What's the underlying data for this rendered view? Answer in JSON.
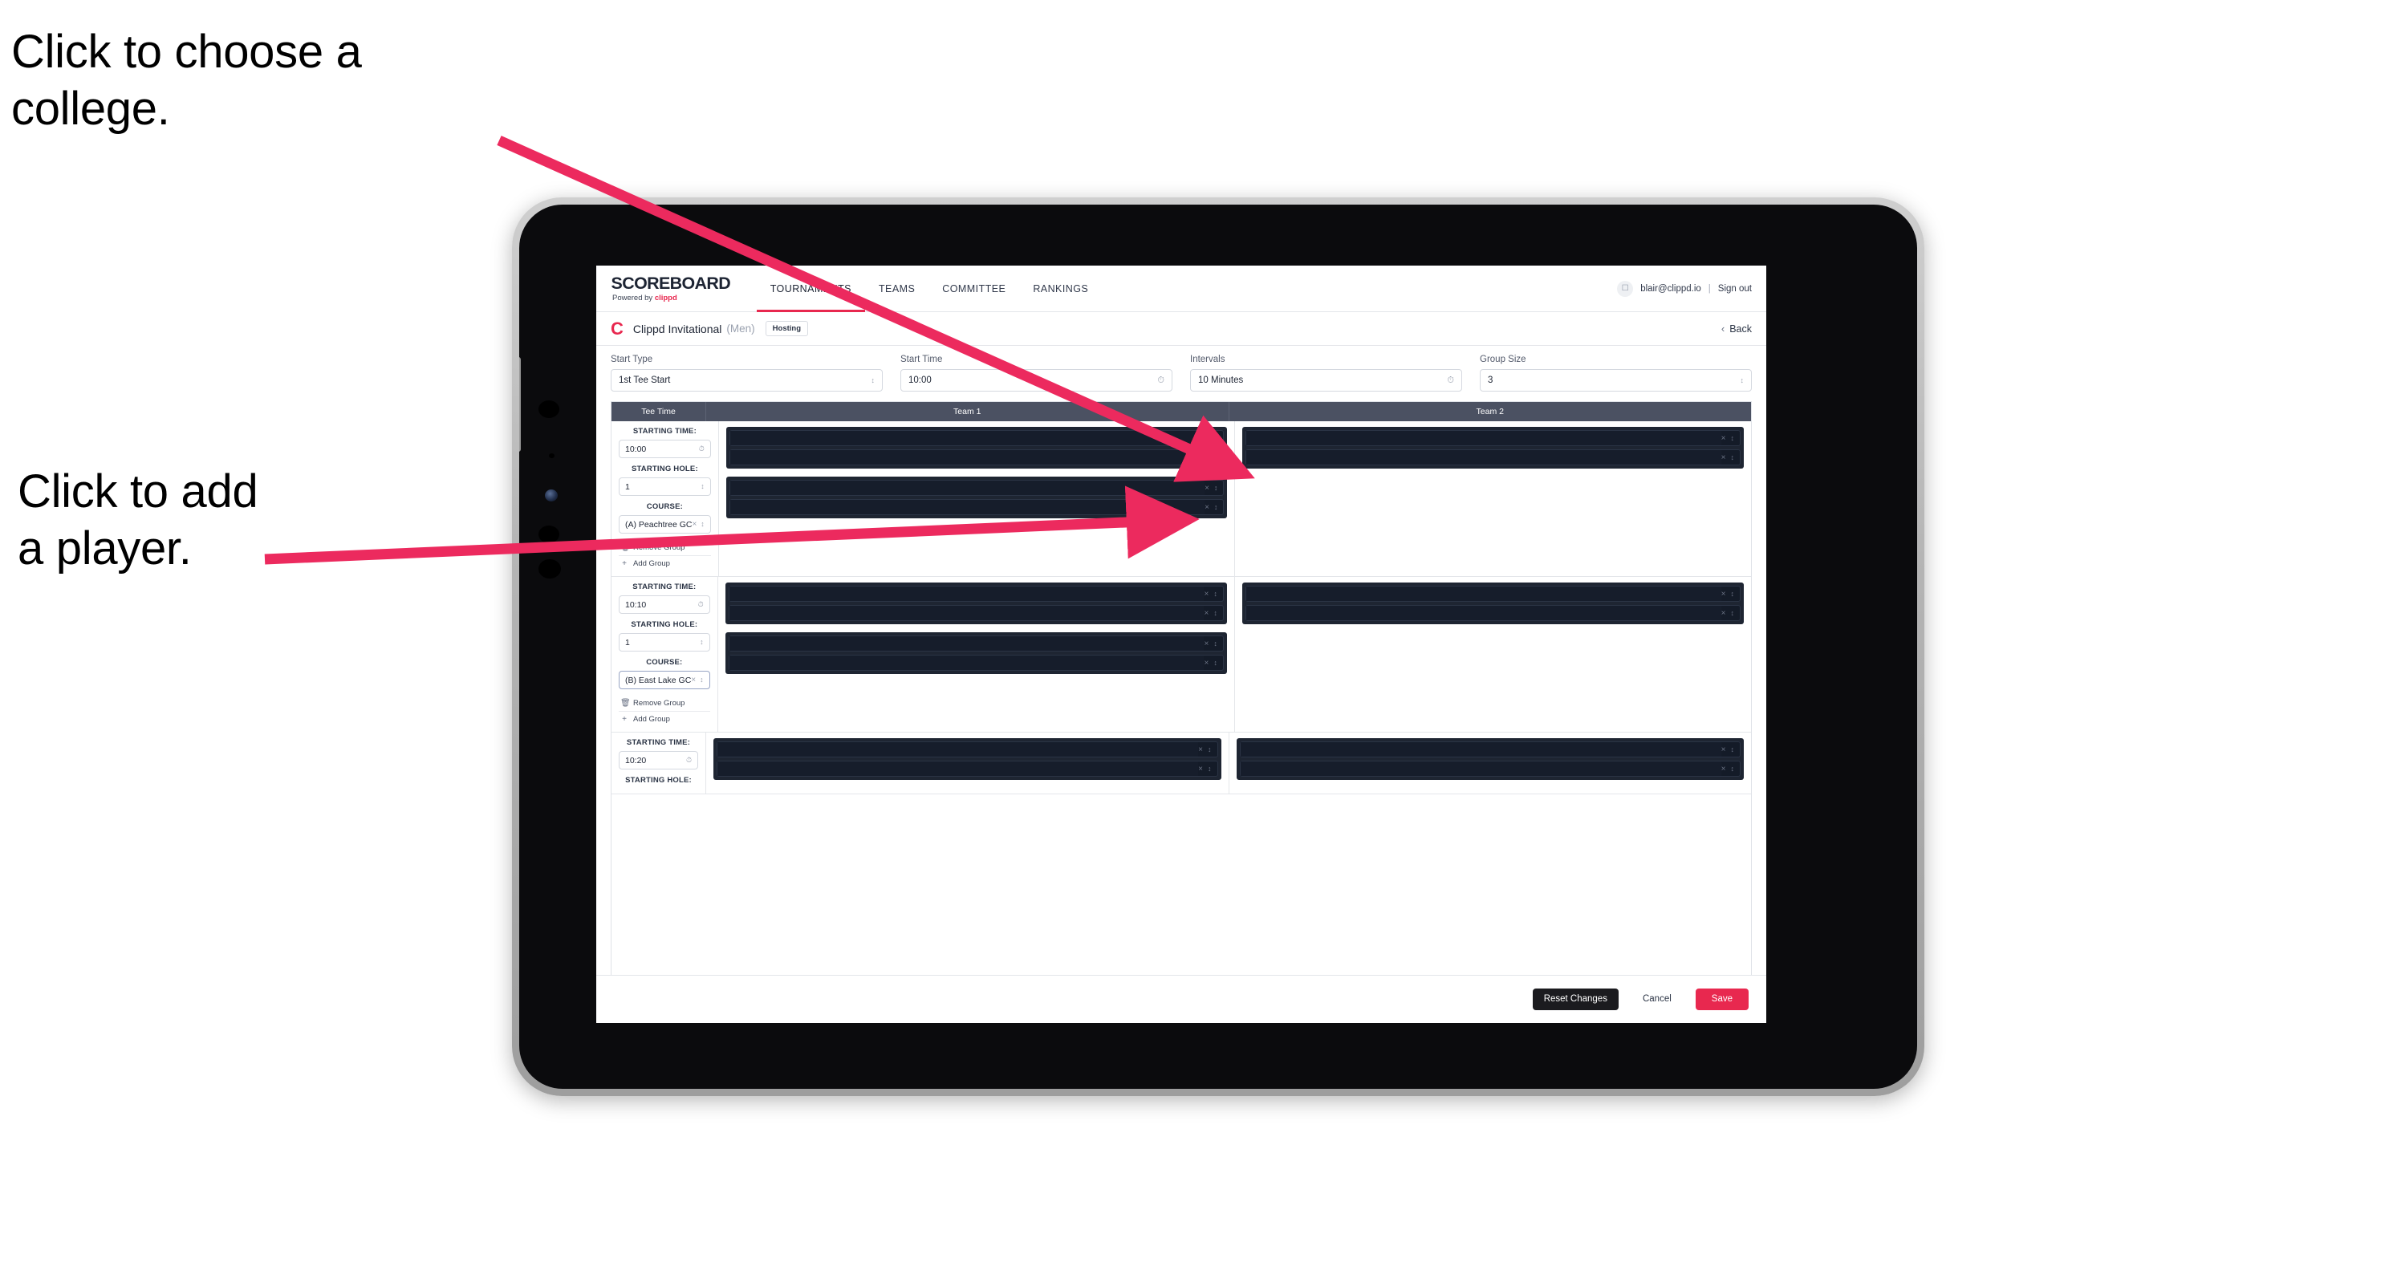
{
  "annotations": {
    "choose_college": "Click to choose a\ncollege.",
    "add_player": "Click to add\na player.",
    "arrow_color": "#ec2a5e"
  },
  "device": {
    "bezel_color": "#b5b5b5",
    "screen_color": "#0b0b0d"
  },
  "topnav": {
    "brand_title": "SCOREBOARD",
    "brand_sub_prefix": "Powered by ",
    "brand_sub_accent": "clippd",
    "items": [
      {
        "label": "TOURNAMENTS",
        "active": true
      },
      {
        "label": "TEAMS",
        "active": false
      },
      {
        "label": "COMMITTEE",
        "active": false
      },
      {
        "label": "RANKINGS",
        "active": false
      }
    ],
    "avatar_icon": "user-avatar-icon",
    "user_email": "blair@clippd.io",
    "separator": "|",
    "sign_out_label": "Sign out",
    "active_underline_color": "#e8284f"
  },
  "subheader": {
    "logo_letter": "C",
    "tournament_name": "Clippd Invitational",
    "gender": "(Men)",
    "hosting_badge": "Hosting",
    "back_chevron": "‹",
    "back_label": "Back"
  },
  "controls": [
    {
      "label": "Start Type",
      "value": "1st Tee Start",
      "icon": "stepper-icon"
    },
    {
      "label": "Start Time",
      "value": "10:00",
      "icon": "clock-icon"
    },
    {
      "label": "Intervals",
      "value": "10 Minutes",
      "icon": "clock-icon"
    },
    {
      "label": "Group Size",
      "value": "3",
      "icon": "stepper-icon"
    }
  ],
  "table": {
    "header_bg": "#4b5162",
    "columns": [
      "Tee Time",
      "Team 1",
      "Team 2"
    ],
    "labels": {
      "starting_time": "STARTING TIME:",
      "starting_hole": "STARTING HOLE:",
      "course": "COURSE:",
      "remove_group": "Remove Group",
      "add_group": "Add Group"
    },
    "rows": [
      {
        "starting_time": "10:00",
        "starting_hole": "1",
        "course": "(A) Peachtree GC",
        "course_focused": false,
        "team1_groups": [
          2,
          2
        ],
        "team2_groups": [
          2
        ]
      },
      {
        "starting_time": "10:10",
        "starting_hole": "1",
        "course": "(B) East Lake GC",
        "course_focused": true,
        "team1_groups": [
          2,
          2
        ],
        "team2_groups": [
          2
        ]
      },
      {
        "starting_time": "10:20",
        "starting_hole": "",
        "course": "",
        "course_focused": false,
        "team1_groups": [
          2
        ],
        "team2_groups": [
          2
        ]
      }
    ]
  },
  "footer": {
    "reset_label": "Reset Changes",
    "cancel_label": "Cancel",
    "save_label": "Save",
    "save_color": "#e8284f"
  }
}
